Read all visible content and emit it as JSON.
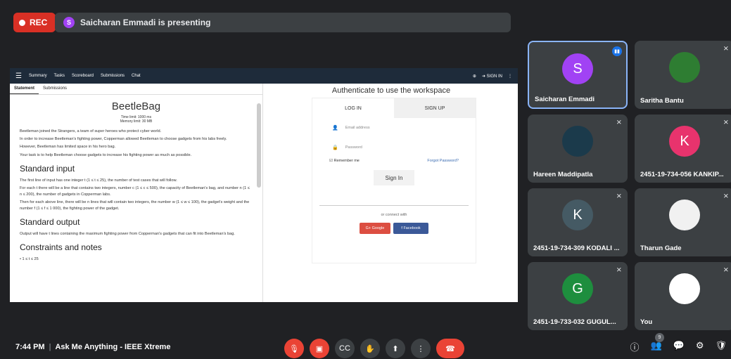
{
  "topbar": {
    "rec_label": "REC",
    "presenter_initial": "S",
    "presenting_text": "Saicharan Emmadi is presenting"
  },
  "presentation": {
    "appbar": {
      "nav": [
        "Summary",
        "Tasks",
        "Scoreboard",
        "Submissions",
        "Chat"
      ],
      "signin": "SIGN IN"
    },
    "left": {
      "tabs": [
        "Statement",
        "Submissions"
      ],
      "title": "BeetleBag",
      "time_limit": "Time limit: 1000 ms",
      "memory_limit": "Memory limit: 30 MB",
      "paragraphs": [
        "Beetleman joined the Strangers, a team of super heroes who protect cyber world.",
        "In order to increase Beetleman's fighting power, Copperman allowed Beetleman to choose gadgets from his labs freely.",
        "However, Beetleman has limited space in his hero bag.",
        "Your task is to help Beetleman choose gadgets to increase his fighting power as much as possible."
      ],
      "h_input": "Standard input",
      "input_paragraphs": [
        "The first line of input has one integer t (1 ≤ t ≤ 25), the number of test cases that will follow.",
        "For each t there will be a line that contains two integers, number c (1 ≤ c ≤ 500), the capacity of Beetleman's bag, and number n (1 ≤ n ≤ 200), the number of gadgets in Copperman labs.",
        "Then for each above line, there will be n lines that will contain two integers, the number w (1 ≤ w ≤ 100), the gadget's weight and the number f (1 ≤ f ≤ 1 000), the fighting power of the gadget."
      ],
      "h_output": "Standard output",
      "output_paragraph": "Output will have t lines containing the maximum fighting power from Copperman's gadgets that can fit into Beetleman's bag.",
      "h_constraints": "Constraints and notes",
      "constraint_1": "• 1 ≤ t ≤ 25"
    },
    "right": {
      "title": "Authenticate to use the workspace",
      "tab_login": "LOG IN",
      "tab_signup": "SIGN UP",
      "email_placeholder": "Email address",
      "password_placeholder": "Password",
      "remember": "Remember me",
      "forgot": "Forgot Password?",
      "signin_button": "Sign In",
      "connect": "or connect with",
      "google": "G+ Google",
      "facebook": "f  Facebook"
    }
  },
  "tiles": [
    {
      "name": "Saicharan Emmadi",
      "initial": "S",
      "color": "#a142f4"
    },
    {
      "name": "Saritha Bantu",
      "initial": "",
      "color": "#2e7d32"
    },
    {
      "name": "Hareen Maddipatla",
      "initial": "",
      "color": "#1b3a4b"
    },
    {
      "name": "2451-19-734-056 KANKIP...",
      "initial": "K",
      "color": "#e8336d"
    },
    {
      "name": "2451-19-734-309 KODALI ...",
      "initial": "K",
      "color": "#455a64"
    },
    {
      "name": "Tharun Gade",
      "initial": "",
      "color": "#f1f1f1"
    },
    {
      "name": "2451-19-733-032 GUGUL...",
      "initial": "G",
      "color": "#1e8e3e"
    },
    {
      "name": "You",
      "initial": "",
      "color": "#ffffff"
    }
  ],
  "bottombar": {
    "time": "7:44 PM",
    "meeting_name": "Ask Me Anything - IEEE Xtreme",
    "participants_count": "9"
  }
}
